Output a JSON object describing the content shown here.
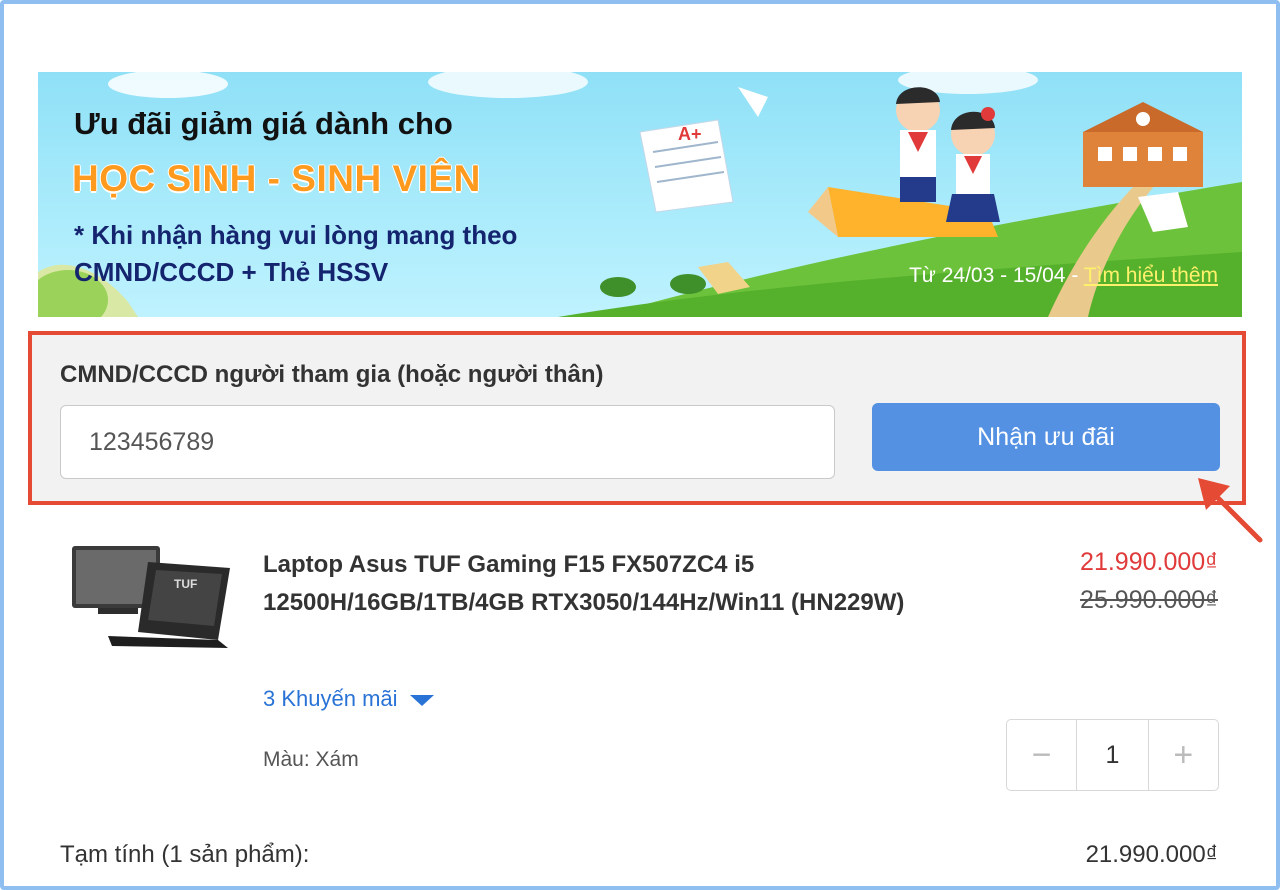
{
  "banner": {
    "line1": "Ưu đãi giảm giá dành cho",
    "line2": "HỌC SINH - SINH VIÊN",
    "line3": "* Khi nhận hàng vui lòng mang theo",
    "line4": "CMND/CCCD + Thẻ HSSV",
    "date_range": "Từ 24/03 - 15/04",
    "separator": " - ",
    "learn_more": "Tìm hiểu thêm"
  },
  "promo_form": {
    "label": "CMND/CCCD người tham gia (hoặc người thân)",
    "id_value": "123456789",
    "submit_label": "Nhận ưu đãi"
  },
  "product": {
    "name": "Laptop Asus TUF Gaming F15 FX507ZC4 i5 12500H/16GB/1TB/4GB RTX3050/144Hz/Win11 (HN229W)",
    "price_new": "21.990.000₫",
    "price_old": "25.990.000₫",
    "promotions_link": "3 Khuyến mãi",
    "color": "Màu: Xám",
    "quantity": "1",
    "minus": "−",
    "plus": "+"
  },
  "summary": {
    "subtotal_label": "Tạm tính (1 sản phẩm):",
    "subtotal_value": "21.990.000₫"
  },
  "colors": {
    "highlight_border": "#e54a35",
    "button": "#5491e3",
    "price": "#e03a3a",
    "link": "#2a73d6"
  }
}
